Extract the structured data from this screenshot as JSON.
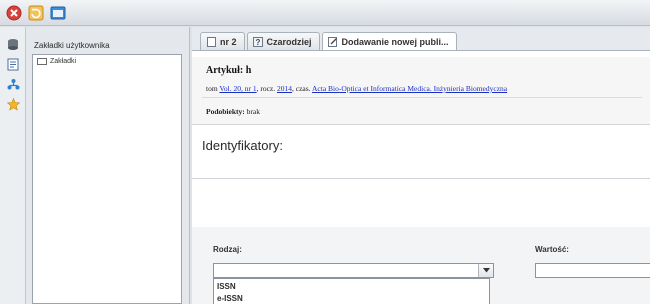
{
  "toolbar": {
    "buttons": [
      {
        "icon": "close-icon",
        "color": "#d9423a"
      },
      {
        "icon": "refresh-icon",
        "color": "#e8a23a"
      },
      {
        "icon": "window-icon",
        "color": "#2f7fd0"
      }
    ]
  },
  "left_strip": {
    "icons": [
      "database-icon",
      "bookmark-page-icon",
      "tree-icon",
      "star-icon"
    ]
  },
  "bookmarks": {
    "title": "Zakładki użytkownika",
    "items": [
      {
        "label": "Zakładki"
      }
    ]
  },
  "tabs": [
    {
      "label": "nr 2",
      "icon": "document-icon",
      "active": false
    },
    {
      "label": "Czarodziej",
      "icon": "wizard-icon",
      "active": false
    },
    {
      "label": "Dodawanie nowej publi...",
      "icon": "edit-document-icon",
      "active": true
    }
  ],
  "article": {
    "title": "Artykuł: h",
    "prefix_tom": "tom",
    "volume_link": "Vol. 20, nr 1",
    "rocz_text": ", rocz.",
    "year_link": "2014",
    "czas_text": ", czas.",
    "journal_link": "Acta Bio-Optica et Informatica Medica. Inżynieria Biomedyczna",
    "subobjects_label": "Podobiekty:",
    "subobjects_value": "brak"
  },
  "identifiers": {
    "section_title": "Identyfikatory:",
    "type_label": "Rodzaj:",
    "value_label": "Wartość:",
    "type_selected": "",
    "value_text": "",
    "options": [
      "ISSN",
      "e-ISSN"
    ]
  }
}
